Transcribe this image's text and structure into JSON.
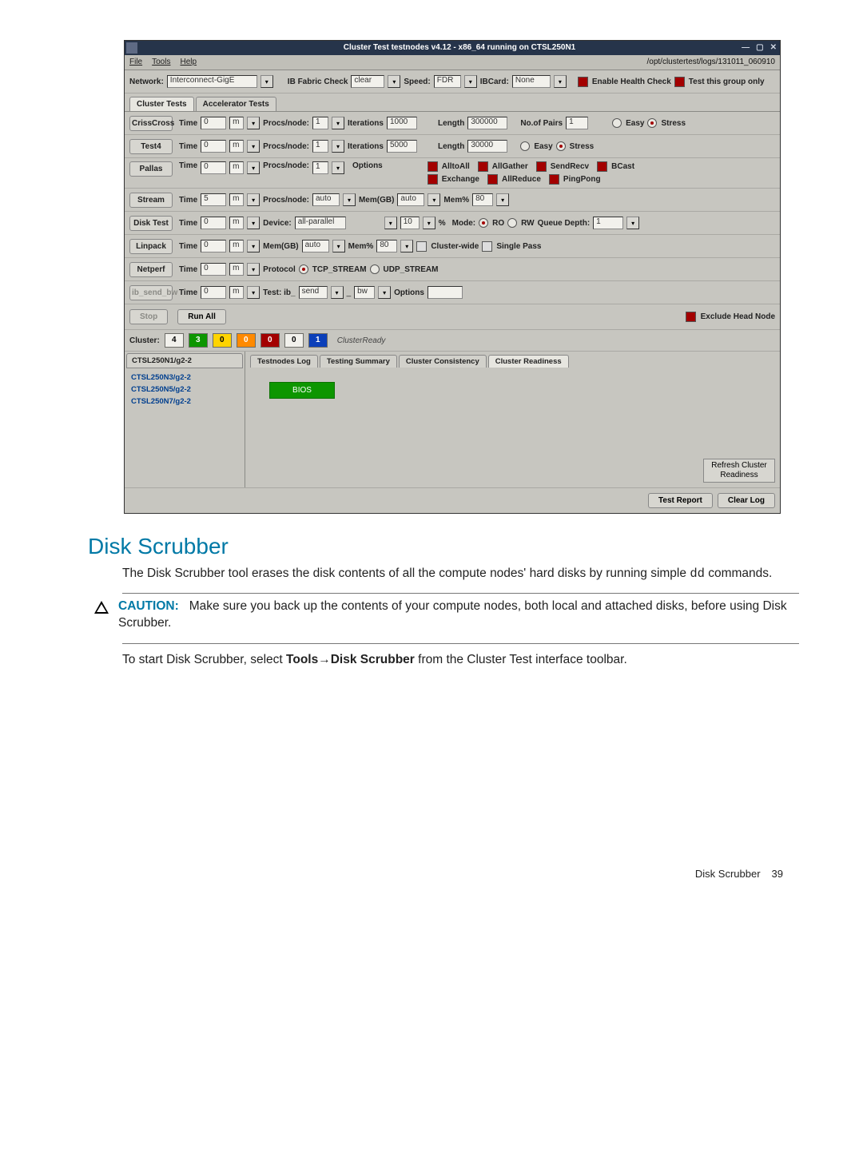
{
  "app": {
    "title": "Cluster Test testnodes v4.12  -  x86_64 running on CTSL250N1",
    "menus": {
      "file": "File",
      "tools": "Tools",
      "help": "Help"
    },
    "logpath": "/opt/clustertest/logs/131011_060910",
    "toolbar": {
      "network_lbl": "Network:",
      "network_val": "Interconnect-GigE",
      "ibfabric_lbl": "IB Fabric Check",
      "ibfabric_val": "clear",
      "speed_lbl": "Speed:",
      "speed_val": "FDR",
      "ibcard_lbl": "IBCard:",
      "ibcard_val": "None",
      "enable_hc": "Enable Health Check",
      "group_only": "Test this group only"
    },
    "tabs": {
      "cluster": "Cluster Tests",
      "accel": "Accelerator Tests"
    },
    "rows": {
      "labels": {
        "time": "Time",
        "m": "m",
        "procs": "Procs/node:",
        "iter": "Iterations",
        "length": "Length",
        "nopairs": "No.of Pairs",
        "easy": "Easy",
        "stress": "Stress",
        "options": "Options",
        "memgb": "Mem(GB)",
        "mempct": "Mem%",
        "device": "Device:",
        "pct": "%",
        "mode": "Mode:",
        "ro": "RO",
        "rw": "RW",
        "qdepth": "Queue Depth:",
        "clusterwide": "Cluster-wide",
        "single": "Single Pass",
        "protocol": "Protocol",
        "tcp": "TCP_STREAM",
        "udp": "UDP_STREAM",
        "test": "Test: ib_",
        "bw": "bw"
      },
      "crisscross": {
        "name": "CrissCross",
        "time": "0",
        "procs": "1",
        "iter": "1000",
        "length": "300000",
        "nopairs": "1"
      },
      "test4": {
        "name": "Test4",
        "time": "0",
        "procs": "1",
        "iter": "5000",
        "length": "30000"
      },
      "pallas": {
        "name": "Pallas",
        "time": "0",
        "procs": "1",
        "opts": {
          "alltoall": "AlltoAll",
          "allgather": "AllGather",
          "sendrecv": "SendRecv",
          "bcast": "BCast",
          "exchange": "Exchange",
          "allreduce": "AllReduce",
          "pingpong": "PingPong"
        }
      },
      "stream": {
        "name": "Stream",
        "time": "5",
        "procs": "auto",
        "memgb": "auto",
        "mempct": "80"
      },
      "disktest": {
        "name": "Disk Test",
        "time": "0",
        "device": "all-parallel",
        "pct": "10",
        "qdepth": "1"
      },
      "linpack": {
        "name": "Linpack",
        "time": "0",
        "memgb": "auto",
        "mempct": "80"
      },
      "netperf": {
        "name": "Netperf",
        "time": "0"
      },
      "ibsend": {
        "name": "ib_send_bw",
        "time": "0",
        "test": "send",
        "bw": "bw"
      }
    },
    "runrow": {
      "stop": "Stop",
      "runall": "Run All",
      "exclude": "Exclude Head Node"
    },
    "cluster": {
      "label": "Cluster:",
      "v4": "4",
      "v3": "3",
      "v0a": "0",
      "v0b": "0",
      "v0c": "0",
      "v0d": "0",
      "v1": "1",
      "ready": "ClusterReady"
    },
    "nodes": {
      "top": "CTSL250N1/g2-2",
      "list": [
        "CTSL250N3/g2-2",
        "CTSL250N5/g2-2",
        "CTSL250N7/g2-2"
      ]
    },
    "subtabs": {
      "log": "Testnodes Log",
      "summary": "Testing Summary",
      "consistency": "Cluster Consistency",
      "readiness": "Cluster Readiness"
    },
    "bios": "BIOS",
    "refresh": "Refresh Cluster Readiness",
    "footer": {
      "report": "Test Report",
      "clear": "Clear Log"
    }
  },
  "doc": {
    "h2": "Disk Scrubber",
    "p1a": "The Disk Scrubber tool erases the disk contents of all the compute nodes' hard disks by running simple ",
    "p1code": "dd",
    "p1b": " commands.",
    "caution_label": "CAUTION:",
    "caution": "Make sure you back up the contents of your compute nodes, both local and attached disks, before using Disk Scrubber.",
    "p2a": "To start Disk Scrubber, select ",
    "p2s1": "Tools",
    "p2arrow": "→",
    "p2s2": "Disk Scrubber",
    "p2b": " from the Cluster Test interface toolbar.",
    "foot_label": "Disk Scrubber",
    "foot_num": "39"
  }
}
